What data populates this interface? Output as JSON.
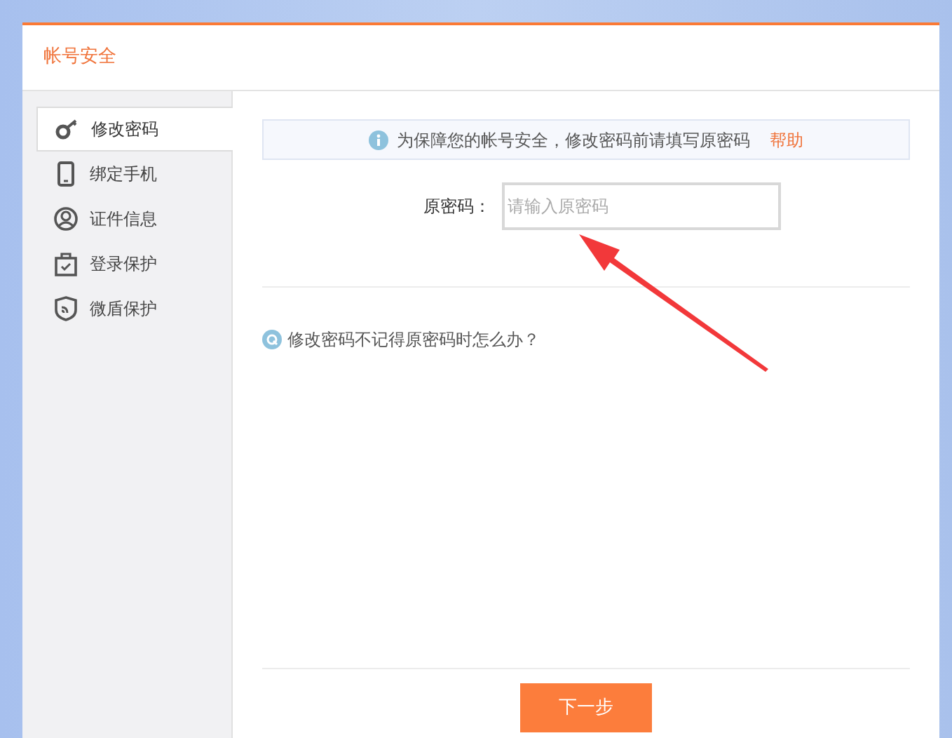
{
  "panel": {
    "title": "帐号安全"
  },
  "sidebar": {
    "items": [
      {
        "label": "修改密码",
        "selected": true
      },
      {
        "label": "绑定手机",
        "selected": false
      },
      {
        "label": "证件信息",
        "selected": false
      },
      {
        "label": "登录保护",
        "selected": false
      },
      {
        "label": "微盾保护",
        "selected": false
      }
    ]
  },
  "notice": {
    "text": "为保障您的帐号安全，修改密码前请填写原密码",
    "link": "帮助"
  },
  "form": {
    "label": "原密码：",
    "placeholder": "请输入原密码"
  },
  "faq": {
    "text": "修改密码不记得原密码时怎么办？"
  },
  "next_button": "下一步"
}
